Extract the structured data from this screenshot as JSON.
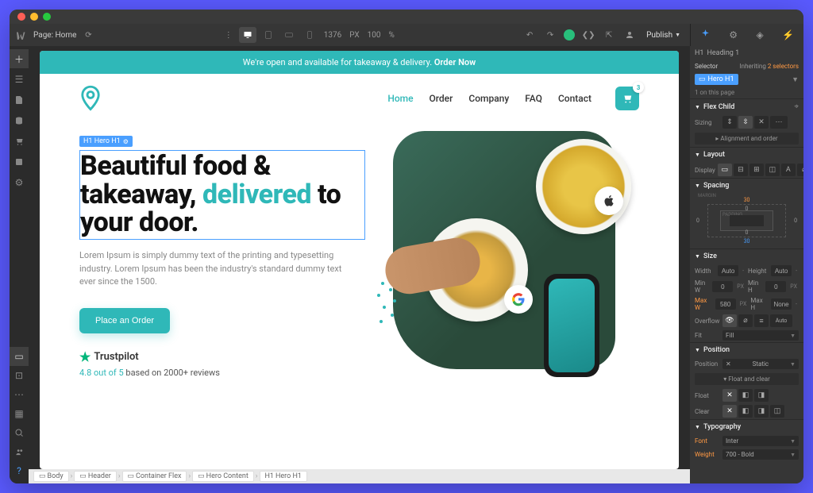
{
  "topbar": {
    "page_label": "Page:",
    "page_name": "Home",
    "viewport_width": "1376",
    "viewport_unit": "PX",
    "zoom": "100",
    "zoom_unit": "%",
    "publish": "Publish"
  },
  "webpage": {
    "banner_text": "We're open and available for takeaway & delivery. ",
    "banner_cta": "Order Now",
    "nav": {
      "home": "Home",
      "order": "Order",
      "company": "Company",
      "faq": "FAQ",
      "contact": "Contact",
      "cart_count": "3"
    },
    "hero": {
      "tag": "H1 Hero H1",
      "headline_1": "Beautiful food & takeaway, ",
      "headline_accent": "delivered",
      "headline_2": " to your door.",
      "subtext": "Lorem Ipsum is simply dummy text of the printing and typesetting industry. Lorem Ipsum has been the industry's standard dummy text ever since the 1500.",
      "cta": "Place an Order",
      "trustpilot": "Trustpilot",
      "reviews_score": "4.8 out of 5",
      "reviews_text": " based on 2000+ reviews"
    }
  },
  "breadcrumb": {
    "items": [
      "Body",
      "Header",
      "Container Flex",
      "Hero Content",
      "Hero H1"
    ]
  },
  "panel": {
    "element_type": "Heading 1",
    "selector_label": "Selector",
    "inheriting": "Inheriting ",
    "inheriting_count": "2 selectors",
    "class_name": "Hero H1",
    "on_page": "1 on this page",
    "flex_child": {
      "title": "Flex Child",
      "sizing": "Sizing",
      "align_order": "Alignment and order"
    },
    "layout": {
      "title": "Layout",
      "display": "Display"
    },
    "spacing": {
      "title": "Spacing",
      "margin_label": "MARGIN",
      "padding_label": "PADDING",
      "margin_top": "30",
      "margin_bottom": "30",
      "margin_left": "0",
      "margin_right": "0",
      "padding_top": "0",
      "padding_bottom": "0"
    },
    "size": {
      "title": "Size",
      "width": "Width",
      "width_val": "Auto",
      "height": "Height",
      "height_val": "Auto",
      "minw": "Min W",
      "minw_val": "0",
      "minh": "Min H",
      "minh_val": "0",
      "maxw": "Max W",
      "maxw_val": "580",
      "maxh": "Max H",
      "maxh_val": "None",
      "px": "PX",
      "overflow": "Overflow",
      "auto": "Auto",
      "fit": "Fit",
      "fit_val": "Fill"
    },
    "position": {
      "title": "Position",
      "position": "Position",
      "position_val": "Static",
      "float_clear": "Float and clear",
      "float": "Float",
      "clear": "Clear"
    },
    "typography": {
      "title": "Typography",
      "font": "Font",
      "font_val": "Inter",
      "weight": "Weight",
      "weight_val": "700 - Bold"
    }
  }
}
